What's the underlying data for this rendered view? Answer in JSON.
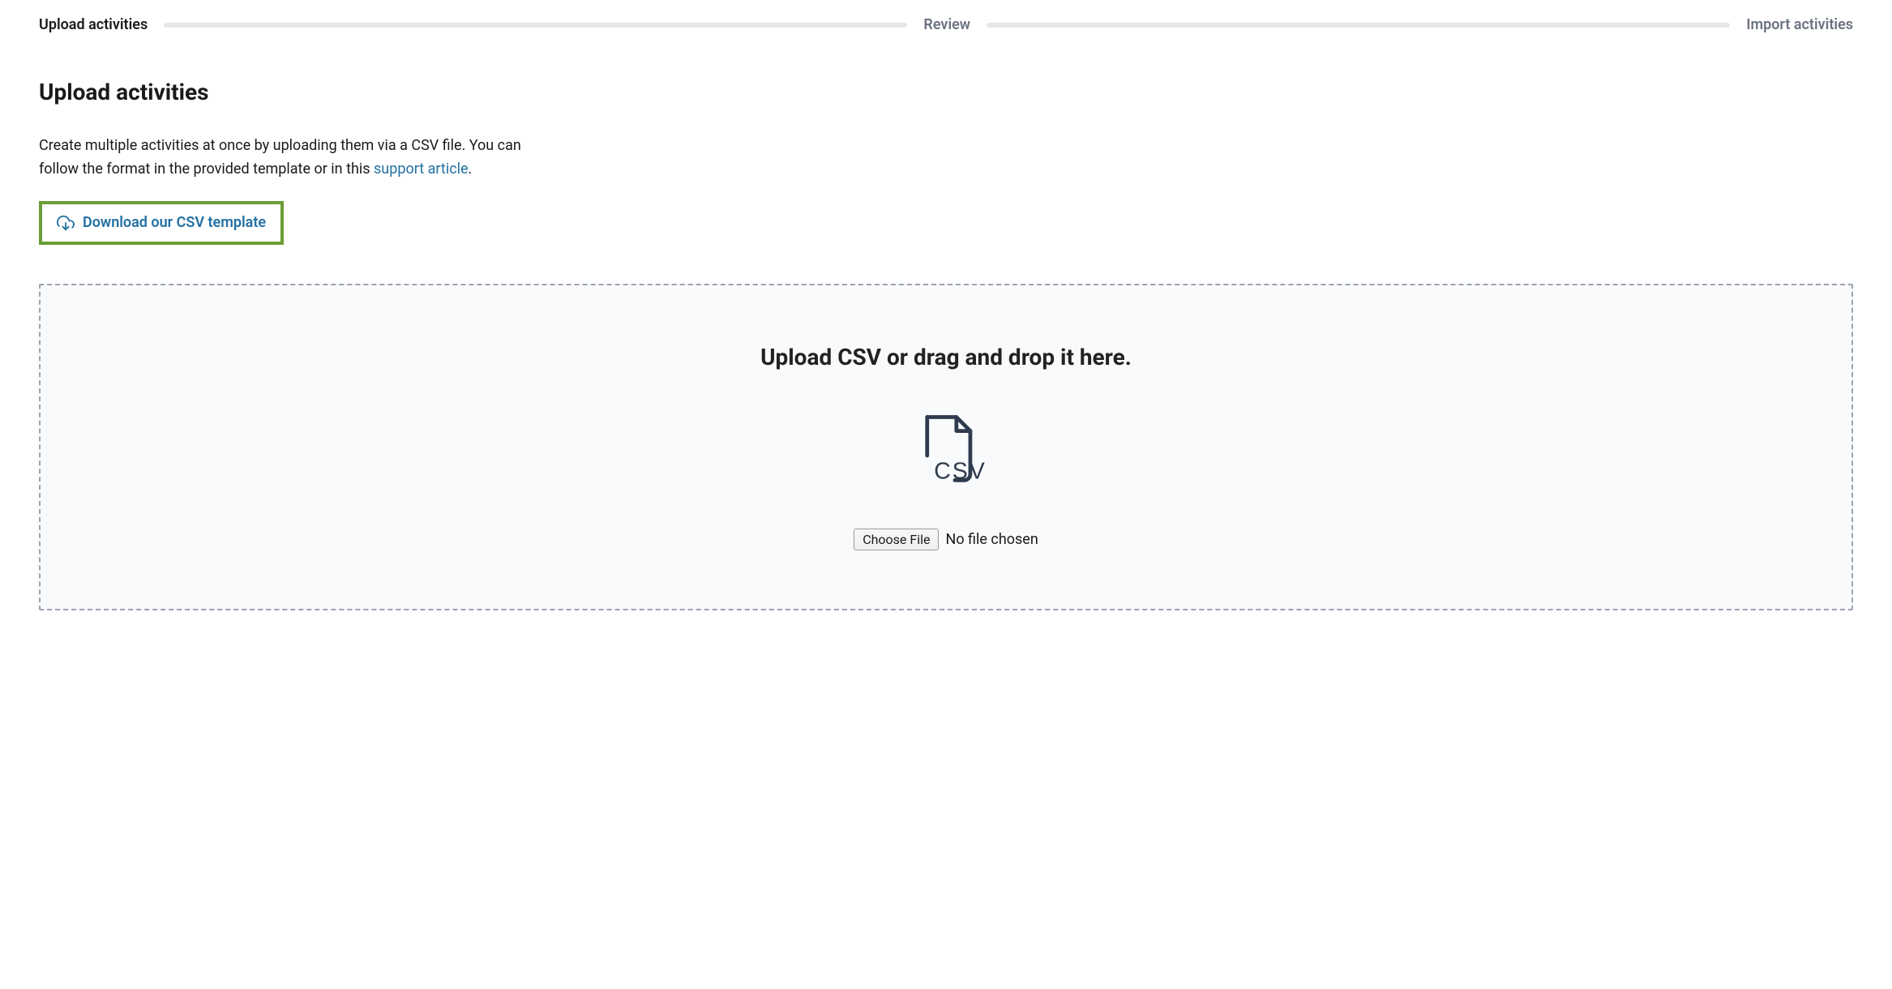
{
  "stepper": {
    "steps": [
      {
        "label": "Upload activities",
        "active": true
      },
      {
        "label": "Review",
        "active": false
      },
      {
        "label": "Import activities",
        "active": false
      }
    ]
  },
  "page": {
    "title": "Upload activities",
    "description_pre": "Create multiple activities at once by uploading them via a CSV file. You can follow the format in the provided template or in this ",
    "support_link_text": "support article",
    "description_post": "."
  },
  "download": {
    "label": "Download our CSV template"
  },
  "dropzone": {
    "title": "Upload CSV or drag and drop it here.",
    "choose_file_label": "Choose File",
    "file_status": "No file chosen"
  }
}
